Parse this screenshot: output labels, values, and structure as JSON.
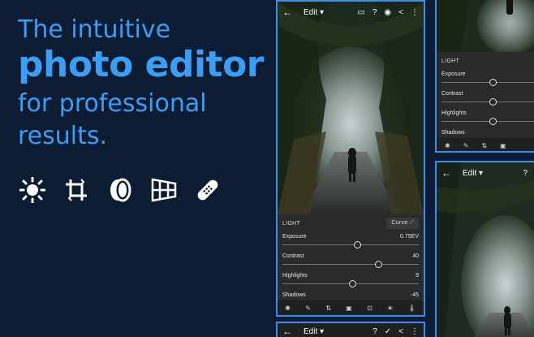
{
  "promo": {
    "line1": "The intuitive",
    "line2": "photo editor",
    "line3a": "for professional",
    "line3b": "results."
  },
  "tools": [
    "sun-icon",
    "crop-icon",
    "lens-icon",
    "grid-icon",
    "bandage-icon"
  ],
  "main_phone": {
    "back": "←",
    "edit_label": "Edit ▾",
    "top_icons": [
      "▭",
      "?",
      "◉",
      "<",
      "⋮"
    ],
    "panel_title": "LIGHT",
    "curve_label": "Curve ⟋",
    "sliders": [
      {
        "label": "Exposure",
        "value": "0.75EV",
        "level": 0.55
      },
      {
        "label": "Contrast",
        "value": "40",
        "level": 0.7
      },
      {
        "label": "Highlights",
        "value": "9",
        "level": 0.51
      },
      {
        "label": "Shadows",
        "value": "-45",
        "level": 0.3
      }
    ],
    "bottom_icons": [
      "✺",
      "✎",
      "⇅",
      "▣",
      "⊡",
      "☀",
      "🌡"
    ]
  },
  "right_top_phone": {
    "panel_title": "LIGHT",
    "sliders": [
      {
        "label": "Exposure",
        "level": 0.55
      },
      {
        "label": "Contrast",
        "level": 0.55
      },
      {
        "label": "Highlights",
        "level": 0.55
      },
      {
        "label": "Shadows",
        "level": 0.55
      }
    ],
    "bottom_icons": [
      "✺",
      "✎",
      "⇅",
      "▣"
    ]
  },
  "right_bottom_phone": {
    "back": "←",
    "edit_label": "Edit ▾",
    "top_icons": [
      "?"
    ]
  },
  "bottom_phone": {
    "back": "←",
    "edit_label": "Edit ▾",
    "top_icons": [
      "?",
      "✓",
      "<",
      "⋮"
    ]
  }
}
